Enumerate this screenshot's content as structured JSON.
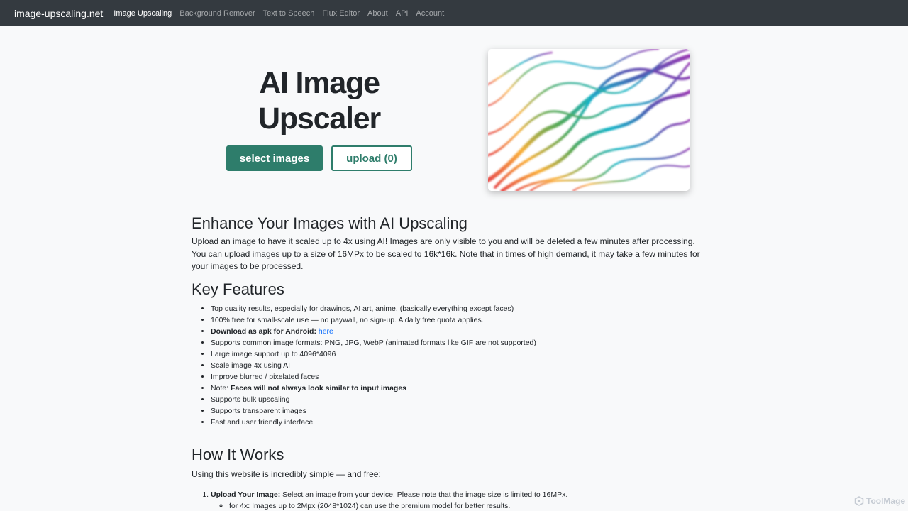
{
  "nav": {
    "brand": "image-upscaling.net",
    "links": [
      {
        "label": "Image Upscaling",
        "active": true
      },
      {
        "label": "Background Remover",
        "active": false
      },
      {
        "label": "Text to Speech",
        "active": false
      },
      {
        "label": "Flux Editor",
        "active": false
      },
      {
        "label": "About",
        "active": false
      },
      {
        "label": "API",
        "active": false
      },
      {
        "label": "Account",
        "active": false
      }
    ]
  },
  "hero": {
    "title_line1": "AI Image",
    "title_line2": "Upscaler",
    "select_label": "select images",
    "upload_label": "upload (0)",
    "accent_color": "#2e7d6b"
  },
  "enhance": {
    "heading": "Enhance Your Images with AI Upscaling",
    "text": "Upload an image to have it scaled up to 4x using AI! Images are only visible to you and will be deleted a few minutes after processing. You can upload images up to a size of 16MPx to be scaled to 16k*16k. Note that in times of high demand, it may take a few minutes for your images to be processed."
  },
  "features": {
    "heading": "Key Features",
    "item1": "Top quality results, especially for drawings, AI art, anime, (basically everything except faces)",
    "item2": "100% free for small-scale use — no paywall, no sign-up. A daily free quota applies.",
    "item3_bold": "Download as apk for Android:",
    "item3_link": "here",
    "item4": "Supports common image formats: PNG, JPG, WebP (animated formats like GIF are not supported)",
    "item5": "Large image support up to 4096*4096",
    "item6": "Scale image 4x using AI",
    "item7": "Improve blurred / pixelated faces",
    "item8_prefix": "Note:",
    "item8_bold": "Faces will not always look similar to input images",
    "item9": "Supports bulk upscaling",
    "item10": "Supports transparent images",
    "item11": "Fast and user friendly interface"
  },
  "how": {
    "heading": "How It Works",
    "intro": "Using this website is incredibly simple — and free:",
    "step1_bold": "Upload Your Image:",
    "step1_text": "Select an image from your device. Please note that the image size is limited to 16MPx.",
    "step1_sub": "for 4x: Images up to 2Mpx (2048*1024) can use the premium model for better results."
  },
  "watermark": "ToolMage"
}
